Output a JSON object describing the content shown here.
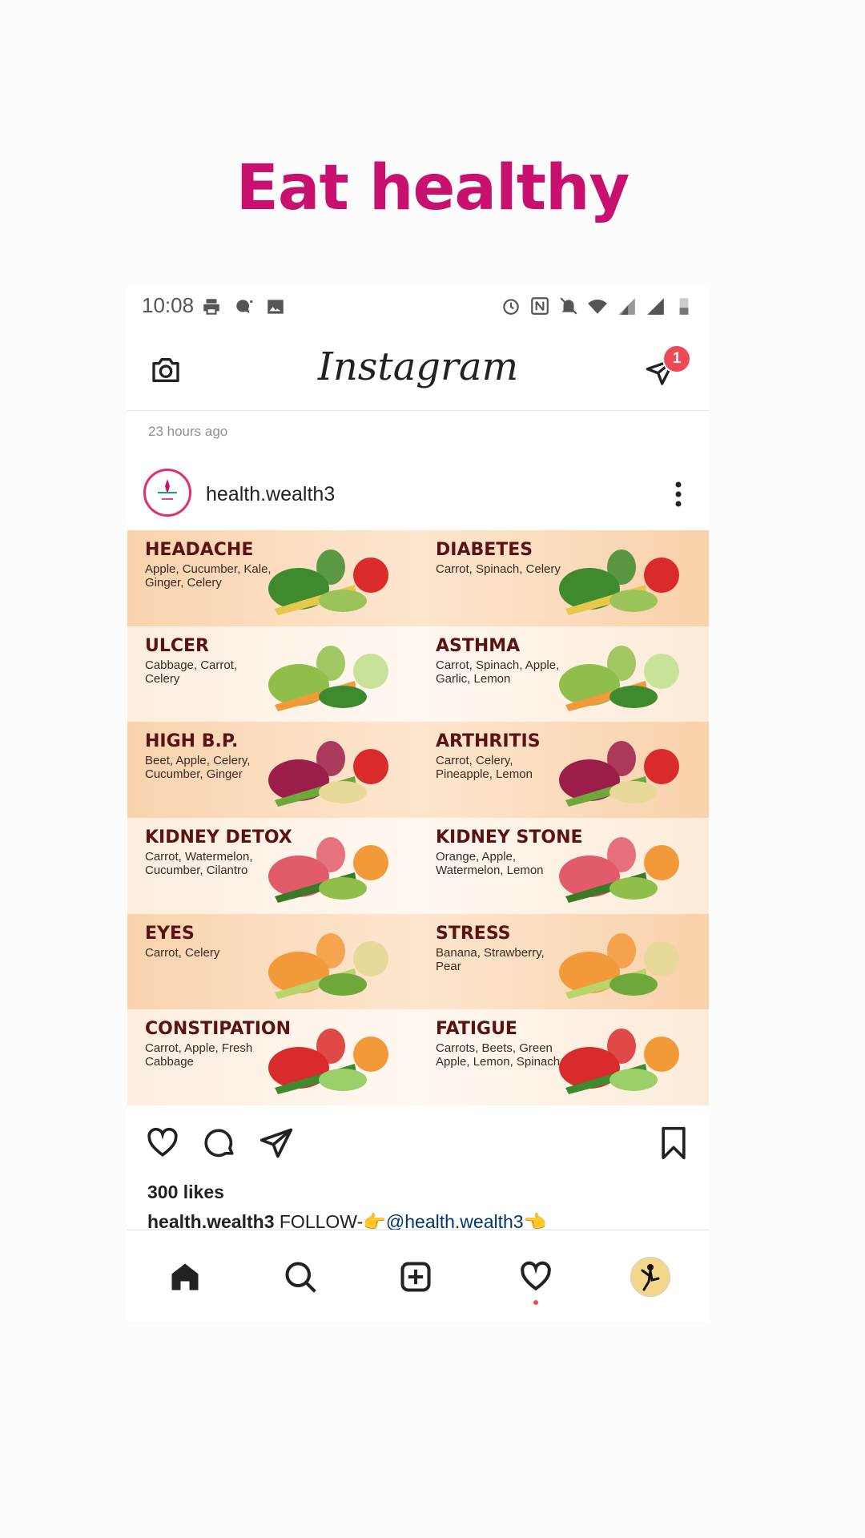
{
  "headline": "Eat healthy",
  "status": {
    "time": "10:08"
  },
  "app": {
    "wordmark": "Instagram",
    "dm_badge": "1"
  },
  "post": {
    "time_ago": "23 hours ago",
    "username": "health.wealth3",
    "likes": "300 likes",
    "caption": {
      "username": "health.wealth3",
      "text": "FOLLOW-👉",
      "mention": "@health.wealth3",
      "suffix": "👈"
    },
    "rows": [
      [
        {
          "condition": "HEADACHE",
          "foods": "Apple, Cucumber, Kale, Ginger, Celery"
        },
        {
          "condition": "DIABETES",
          "foods": "Carrot, Spinach, Celery"
        }
      ],
      [
        {
          "condition": "ULCER",
          "foods": "Cabbage, Carrot, Celery"
        },
        {
          "condition": "ASTHMA",
          "foods": "Carrot, Spinach, Apple, Garlic, Lemon"
        }
      ],
      [
        {
          "condition": "HIGH B.P.",
          "foods": "Beet, Apple, Celery, Cucumber, Ginger"
        },
        {
          "condition": "ARTHRITIS",
          "foods": "Carrot, Celery, Pineapple, Lemon"
        }
      ],
      [
        {
          "condition": "KIDNEY DETOX",
          "foods": "Carrot, Watermelon, Cucumber, Cilantro"
        },
        {
          "condition": "KIDNEY STONE",
          "foods": "Orange, Apple, Watermelon, Lemon"
        }
      ],
      [
        {
          "condition": "EYES",
          "foods": "Carrot, Celery"
        },
        {
          "condition": "STRESS",
          "foods": "Banana, Strawberry, Pear"
        }
      ],
      [
        {
          "condition": "CONSTIPATION",
          "foods": "Carrot, Apple, Fresh Cabbage"
        },
        {
          "condition": "FATIGUE",
          "foods": "Carrots, Beets, Green Apple, Lemon, Spinach"
        }
      ]
    ]
  },
  "colors": {
    "headline": "#c8106e",
    "badge": "#ed4956",
    "condition_text": "#5b1212",
    "mention": "#00376b"
  },
  "icons": [
    "camera-icon",
    "direct-message-icon",
    "more-icon",
    "heart-icon",
    "comment-icon",
    "share-icon",
    "bookmark-icon",
    "home-icon",
    "search-icon",
    "new-post-icon",
    "activity-heart-icon",
    "profile-avatar"
  ]
}
